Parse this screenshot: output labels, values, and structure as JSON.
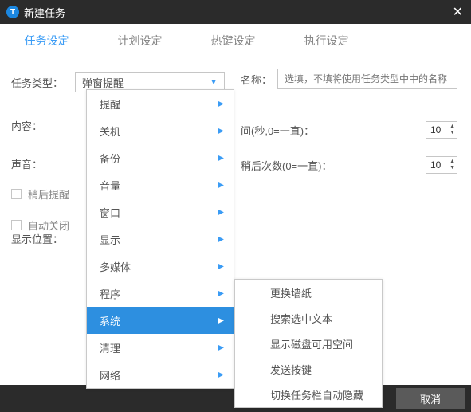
{
  "window": {
    "title": "新建任务",
    "logo_letter": "T"
  },
  "tabs": [
    {
      "label": "任务设定",
      "active": true
    },
    {
      "label": "计划设定",
      "active": false
    },
    {
      "label": "热键设定",
      "active": false
    },
    {
      "label": "执行设定",
      "active": false
    }
  ],
  "fields": {
    "task_type_label": "任务类型：",
    "task_type_value": "弹窗提醒",
    "name_label": "名称：",
    "name_placeholder": "选填，不填将使用任务类型中中的名称",
    "content_label": "内容：",
    "sound_label": "声音：",
    "interval_label": "间(秒,0=一直)：",
    "interval_value": "10",
    "remind_later_label": "稍后提醒",
    "remind_count_label": "稍后次数(0=一直)：",
    "remind_count_value": "10",
    "auto_close_label": "自动关闭",
    "position_label": "显示位置："
  },
  "menu": {
    "items": [
      {
        "label": "提醒",
        "has_sub": true
      },
      {
        "label": "关机",
        "has_sub": true
      },
      {
        "label": "备份",
        "has_sub": true
      },
      {
        "label": "音量",
        "has_sub": true
      },
      {
        "label": "窗口",
        "has_sub": true
      },
      {
        "label": "显示",
        "has_sub": true
      },
      {
        "label": "多媒体",
        "has_sub": true
      },
      {
        "label": "程序",
        "has_sub": true
      },
      {
        "label": "系统",
        "has_sub": true,
        "hover": true
      },
      {
        "label": "清理",
        "has_sub": true
      },
      {
        "label": "网络",
        "has_sub": true
      }
    ]
  },
  "submenu": {
    "items": [
      {
        "label": "更换墙纸"
      },
      {
        "label": "搜索选中文本"
      },
      {
        "label": "显示磁盘可用空间"
      },
      {
        "label": "发送按键"
      },
      {
        "label": "切换任务栏自动隐藏"
      }
    ]
  },
  "buttons": {
    "cancel": "取消"
  }
}
